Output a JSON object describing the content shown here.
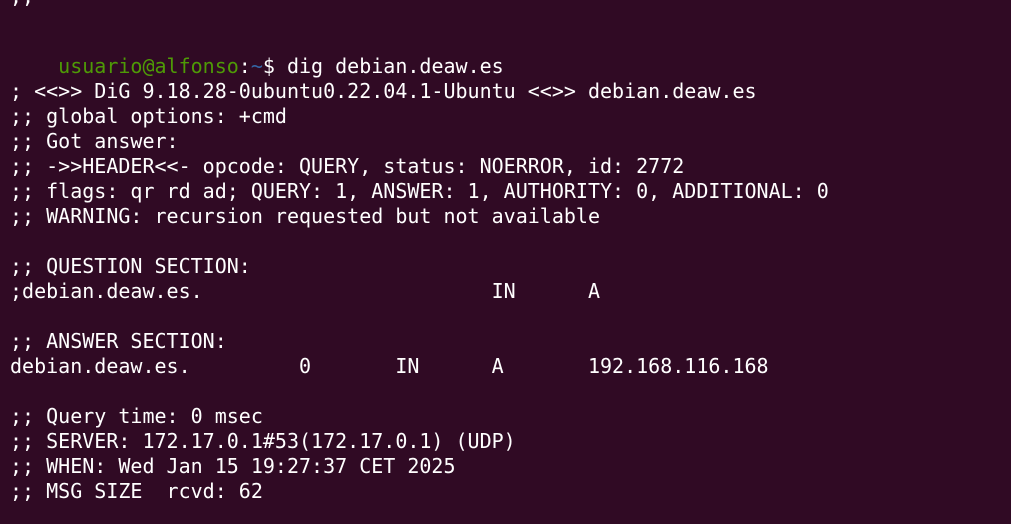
{
  "terminal": {
    "colors": {
      "background": "#300a24",
      "foreground": "#ffffff",
      "prompt_user": "#4e9a06",
      "prompt_path": "#3465a4"
    },
    "prompt": {
      "user_host": "usuario@alfonso",
      "separator": ":",
      "path": "~",
      "symbol": "$",
      "command": " dig debian.deaw.es"
    },
    "lines": [
      ";;",
      "; <<>> DiG 9.18.28-0ubuntu0.22.04.1-Ubuntu <<>> debian.deaw.es",
      ";; global options: +cmd",
      ";; Got answer:",
      ";; ->>HEADER<<- opcode: QUERY, status: NOERROR, id: 2772",
      ";; flags: qr rd ad; QUERY: 1, ANSWER: 1, AUTHORITY: 0, ADDITIONAL: 0",
      ";; WARNING: recursion requested but not available",
      ";; QUESTION SECTION:",
      ";debian.deaw.es.                        IN      A",
      ";; ANSWER SECTION:",
      "debian.deaw.es.         0       IN      A       192.168.116.168",
      ";; Query time: 0 msec",
      ";; SERVER: 172.17.0.1#53(172.17.0.1) (UDP)",
      ";; WHEN: Wed Jan 15 19:27:37 CET 2025",
      ";; MSG SIZE  rcvd: 62"
    ]
  }
}
